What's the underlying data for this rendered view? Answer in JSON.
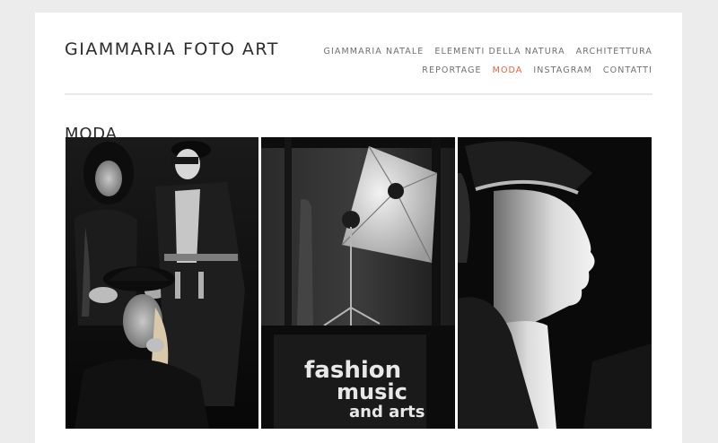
{
  "site": {
    "title": "GIAMMARIA FOTO ART"
  },
  "nav": {
    "row1": [
      "GIAMMARIA NATALE",
      "ELEMENTI DELLA NATURA",
      "ARCHITETTURA"
    ],
    "row2": [
      "REPORTAGE",
      "MODA",
      "INSTAGRAM",
      "CONTATTI"
    ],
    "active": "MODA",
    "active_color": "#e0633c"
  },
  "page": {
    "title": "MODA"
  },
  "gallery": {
    "photos": [
      {
        "subject": "two women with hat and mannequin"
      },
      {
        "subject": "shop window with umbrella light",
        "sign_text": [
          "fashion",
          "music",
          "and arts"
        ]
      },
      {
        "subject": "mannequin head profile with cap"
      }
    ]
  }
}
